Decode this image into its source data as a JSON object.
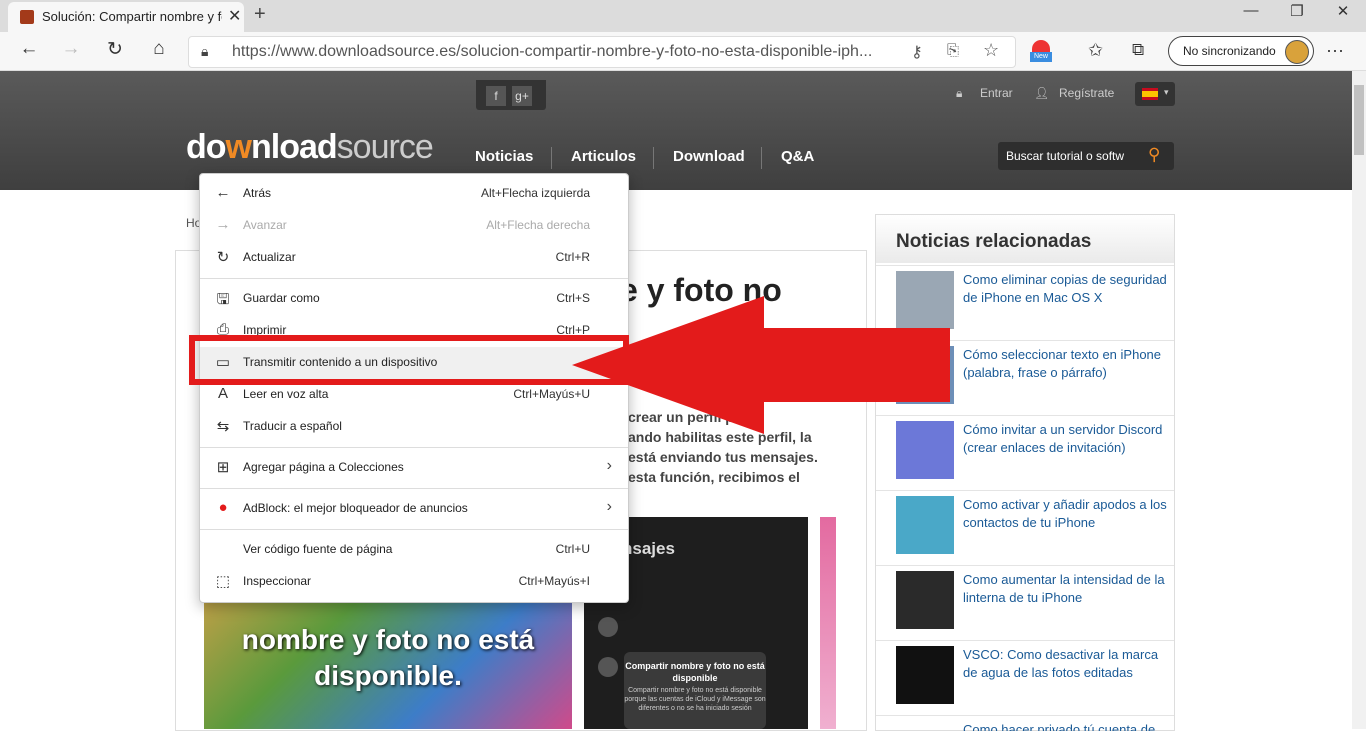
{
  "browser": {
    "tab_title": "Solución: Compartir nombre y fo",
    "tab_close": "✕",
    "new_tab": "+",
    "win_minimize": "—",
    "win_maximize": "❐",
    "win_close": "✕",
    "url": "https://www.downloadsource.es/solucion-compartir-nombre-y-foto-no-esta-disponible-iph...",
    "sync_label": "No sincronizando",
    "menu_dots": "···",
    "new_badge": "New"
  },
  "site": {
    "logo_main": "do",
    "logo_mark": "w",
    "logo_rest": "nload",
    "logo_light": "source",
    "nav": [
      "Noticias",
      "Articulos",
      "Download",
      "Q&A"
    ],
    "search_placeholder": "Buscar tutorial o softw",
    "login": "Entrar",
    "register": "Regístrate",
    "social_f": "f",
    "social_g": "g+"
  },
  "article": {
    "breadcrumb_fragment": "Ho",
    "title_fragment": "e y foto no",
    "body_lines": [
      "crear un perfil p       app",
      "ando habilitas este perfil, la",
      "está enviando tus mensajes.",
      "esta función, recibimos el"
    ],
    "image_caption": "nombre y foto no está disponible.",
    "phone_header": "nsajes",
    "phone_card_title": "Compartir nombre y foto no está disponible",
    "phone_card_body": "Compartir nombre y foto no está disponible porque las cuentas de iCloud y iMessage son diferentes o no se ha iniciado sesión"
  },
  "sidebar": {
    "title": "Noticias relacionadas",
    "items": [
      {
        "text": "Como eliminar copias de seguridad de iPhone en Mac OS X"
      },
      {
        "text": "Cómo seleccionar texto en iPhone (palabra, frase o párrafo)"
      },
      {
        "text": "Cómo invitar a un servidor Discord (crear enlaces de invitación)"
      },
      {
        "text": "Como activar y añadir apodos a los contactos de tu iPhone"
      },
      {
        "text": "Como aumentar la intensidad de la linterna de tu iPhone"
      },
      {
        "text": "VSCO: Como desactivar la marca de agua de las fotos editadas"
      },
      {
        "text": "Como hacer privado tú cuenta de"
      }
    ]
  },
  "context_menu": {
    "items": [
      {
        "icon": "←",
        "label": "Atrás",
        "shortcut": "Alt+Flecha izquierda"
      },
      {
        "icon": "→",
        "label": "Avanzar",
        "shortcut": "Alt+Flecha derecha"
      },
      {
        "icon": "↻",
        "label": "Actualizar",
        "shortcut": "Ctrl+R"
      },
      {
        "icon": "🖫",
        "label": "Guardar como",
        "shortcut": "Ctrl+S"
      },
      {
        "icon": "⎙",
        "label": "Imprimir",
        "shortcut": "Ctrl+P"
      },
      {
        "icon": "▭",
        "label": "Transmitir contenido a un dispositivo",
        "shortcut": ""
      },
      {
        "icon": "A",
        "label": "Leer en voz alta",
        "shortcut": "Ctrl+Mayús+U"
      },
      {
        "icon": "⇆",
        "label": "Traducir a español",
        "shortcut": ""
      },
      {
        "icon": "⊞",
        "label": "Agregar página a Colecciones",
        "shortcut": "",
        "arrow": "›"
      },
      {
        "icon": "●",
        "label": "AdBlock: el mejor bloqueador de anuncios",
        "shortcut": "",
        "arrow": "›"
      },
      {
        "icon": "",
        "label": "Ver código fuente de página",
        "shortcut": "Ctrl+U"
      },
      {
        "icon": "⬚",
        "label": "Inspeccionar",
        "shortcut": "Ctrl+Mayús+I"
      }
    ]
  },
  "colors": {
    "highlight_red": "#e31b1b",
    "link_blue": "#1a5a96",
    "logo_orange": "#f08a24"
  }
}
